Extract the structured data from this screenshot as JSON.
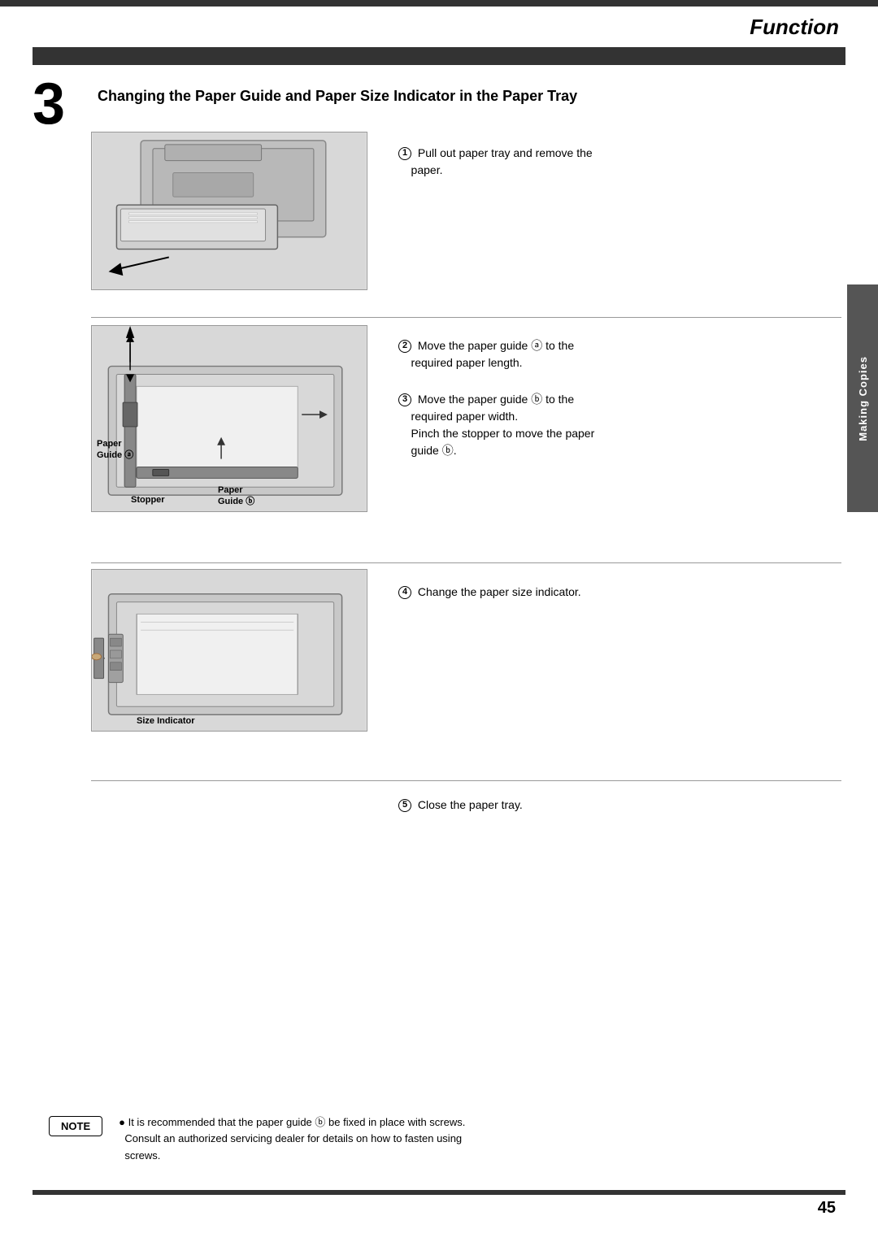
{
  "page": {
    "title": "Function",
    "page_number": "45",
    "section_title": "Changing the Paper Guide and Paper Size Indicator in the Paper Tray",
    "chapter_number": "3",
    "sidebar_label": "Making Copies"
  },
  "instructions": [
    {
      "num": "①",
      "text": "Pull out paper tray and remove the paper."
    },
    {
      "num": "②",
      "text": "Move the paper guide ⓐ to the required paper length."
    },
    {
      "num": "③",
      "text": "Move the paper guide ⓑ to the required paper width.\nPinch the stopper to move the paper guide ⓑ."
    },
    {
      "num": "④",
      "text": "Change the paper size indicator."
    },
    {
      "num": "⑤",
      "text": "Close the paper tray."
    }
  ],
  "diagram_labels": {
    "paper_guide_a": "Paper Guide ⓐ",
    "paper_guide_b": "Paper Guide ⓑ",
    "stopper": "Stopper",
    "size_indicator": "Size Indicator"
  },
  "note": {
    "label": "NOTE",
    "text": "● It is recommended that the paper guide ⓑ be fixed in place with screws.\n  Consult an authorized servicing dealer for details on how to fasten using\n  screws."
  }
}
